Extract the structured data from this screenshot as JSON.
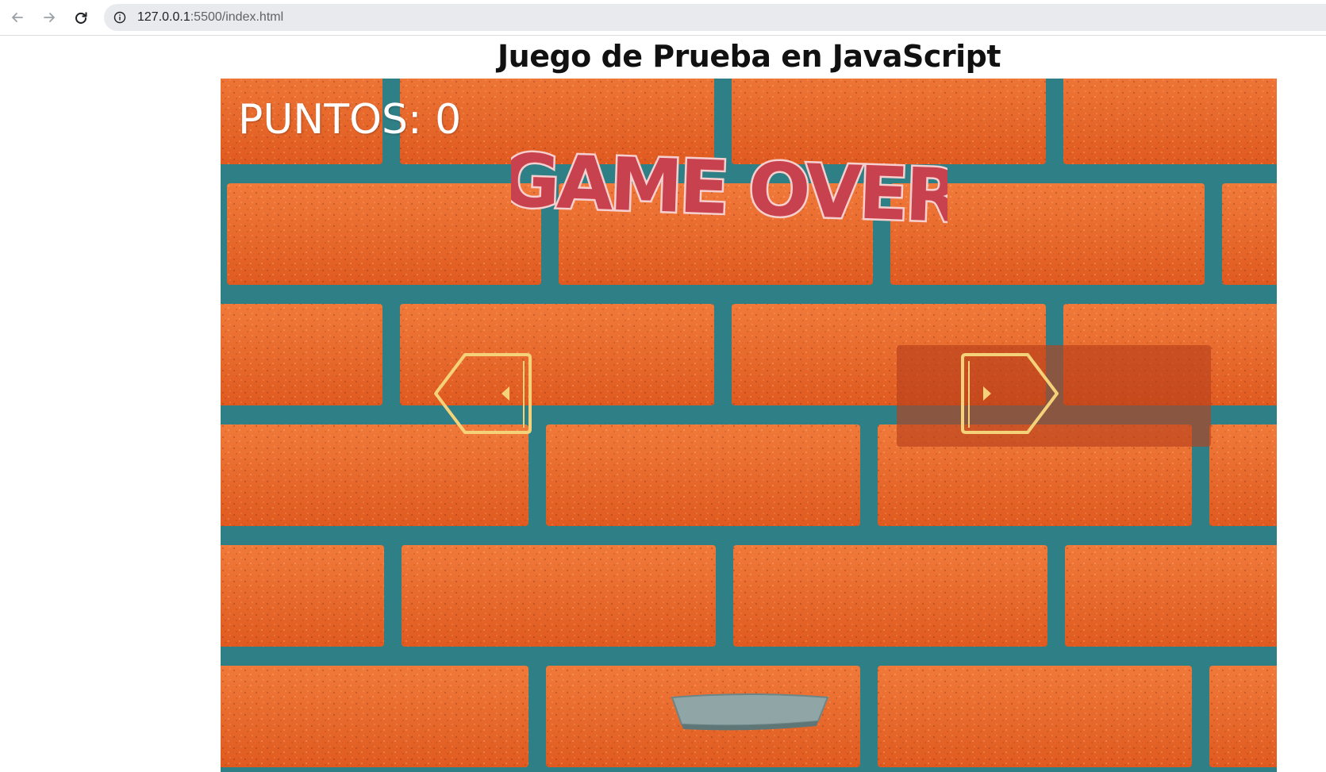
{
  "browser": {
    "url_host": "127.0.0.1",
    "url_path": ":5500/index.html",
    "back_icon": "arrow-left-icon",
    "forward_icon": "arrow-right-icon",
    "reload_icon": "reload-icon",
    "info_icon": "info-icon"
  },
  "page": {
    "title": "Juego de Prueba en JavaScript"
  },
  "game": {
    "score_label": "PUNTOS: 0",
    "status_text": "GAME OVER",
    "left_control_icon": "left-arrow-tag-icon",
    "right_control_icon": "right-arrow-tag-icon",
    "colors": {
      "brick": "#e8672c",
      "mortar": "#2f7f86",
      "game_over_fill": "#c8414f",
      "game_over_outline": "#f6d0cf",
      "control_outline": "#f4d27a",
      "paddle": "#8fa5a6"
    }
  }
}
